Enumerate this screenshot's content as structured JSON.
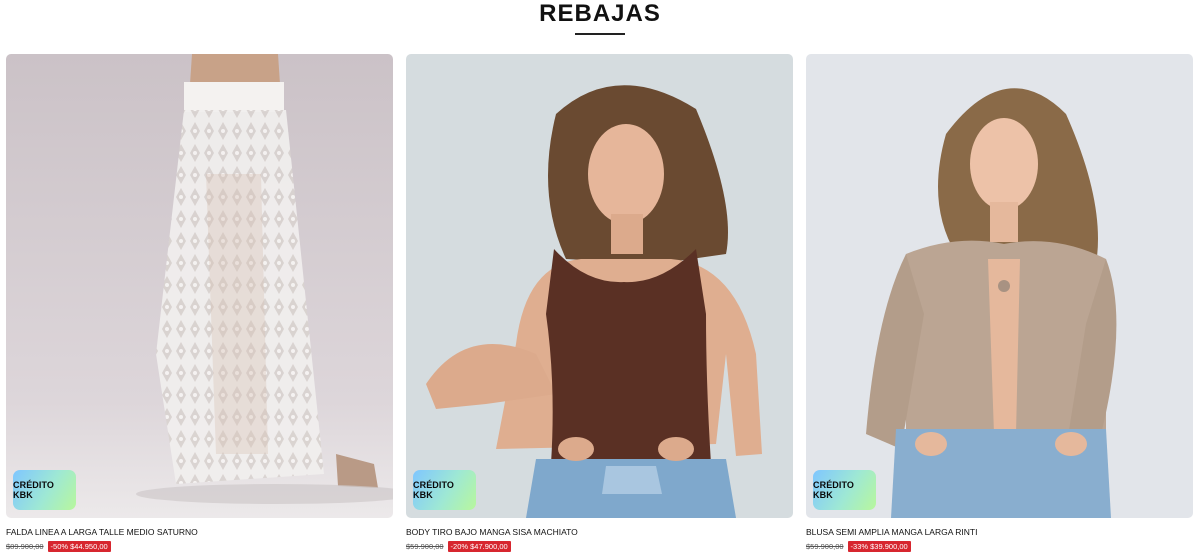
{
  "section": {
    "title": "REBAJAS"
  },
  "badge_label": "CRÉDITO KBK",
  "colors": {
    "sale_red": "#d7262f",
    "text": "#111111"
  },
  "products": [
    {
      "name": "FALDA LINEA A LARGA TALLE MEDIO SATURNO",
      "old_price": "$89.900,00",
      "sale_label": "-50% $44.950,00"
    },
    {
      "name": "BODY TIRO BAJO MANGA SISA MACHIATO",
      "old_price": "$59.900,00",
      "sale_label": "-20% $47.900,00"
    },
    {
      "name": "BLUSA SEMI AMPLIA MANGA LARGA RINTI",
      "old_price": "$59.900,00",
      "sale_label": "-33% $39.900,00"
    }
  ]
}
